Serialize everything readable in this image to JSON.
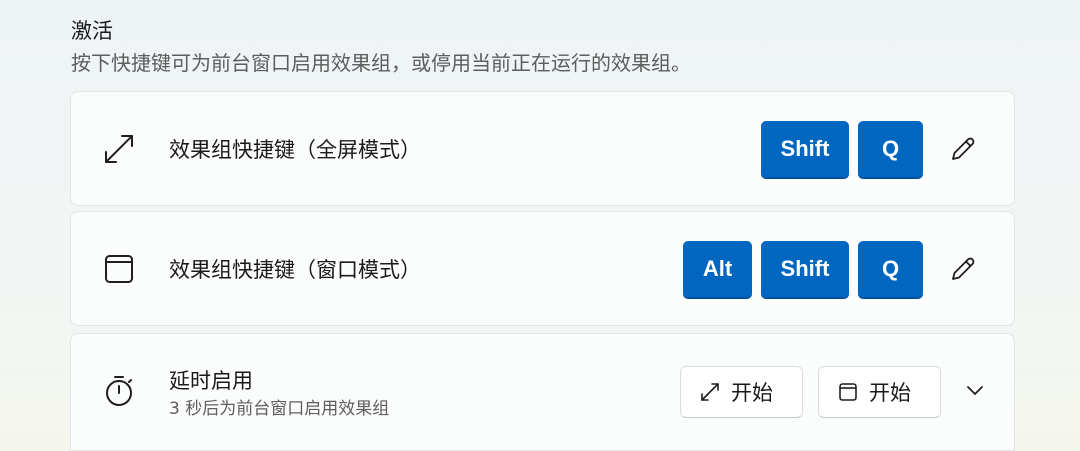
{
  "section": {
    "title": "激活",
    "description": "按下快捷键可为前台窗口启用效果组，或停用当前正在运行的效果组。"
  },
  "rows": {
    "fullscreen": {
      "label": "效果组快捷键（全屏模式）",
      "icon": "expand-arrows-icon",
      "keys": [
        "Shift",
        "Q"
      ]
    },
    "window": {
      "label": "效果组快捷键（窗口模式）",
      "icon": "window-icon",
      "keys": [
        "Alt",
        "Shift",
        "Q"
      ]
    },
    "delay": {
      "label": "延时启用",
      "sublabel": "3 秒后为前台窗口启用效果组",
      "icon": "timer-icon",
      "start_fullscreen_label": "开始",
      "start_window_label": "开始"
    }
  },
  "colors": {
    "accent": "#0067c0",
    "card_bg": "#fbfcfc",
    "secondary_text": "#5d5d5d"
  }
}
